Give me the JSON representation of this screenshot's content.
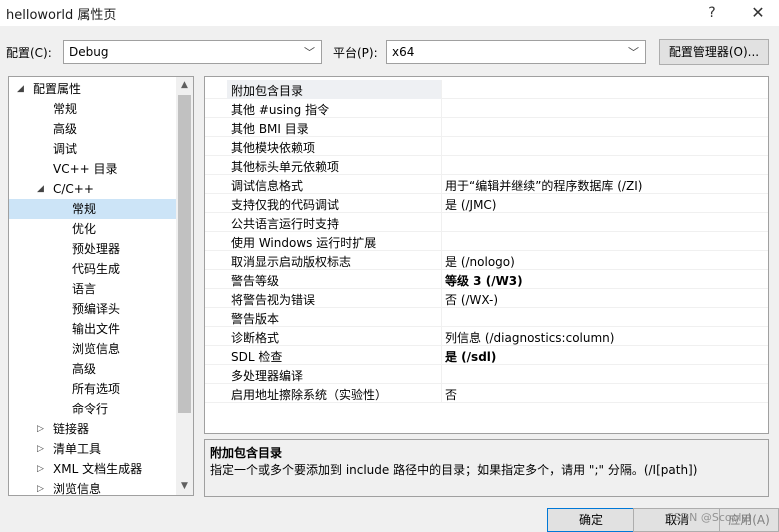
{
  "window": {
    "title": "helloworld 属性页",
    "help_icon": "?",
    "close_icon": "✕"
  },
  "config_bar": {
    "config_label": "配置(C):",
    "config_value": "Debug",
    "platform_label": "平台(P):",
    "platform_value": "x64",
    "manager_button": "配置管理器(O)..."
  },
  "tree": {
    "items": [
      {
        "label": "配置属性",
        "arrow": "◢"
      },
      {
        "label": "常规"
      },
      {
        "label": "高级"
      },
      {
        "label": "调试"
      },
      {
        "label": "VC++ 目录"
      },
      {
        "label": "C/C++",
        "arrow": "◢"
      },
      {
        "label": "常规",
        "selected": true
      },
      {
        "label": "优化"
      },
      {
        "label": "预处理器"
      },
      {
        "label": "代码生成"
      },
      {
        "label": "语言"
      },
      {
        "label": "预编译头"
      },
      {
        "label": "输出文件"
      },
      {
        "label": "浏览信息"
      },
      {
        "label": "高级"
      },
      {
        "label": "所有选项"
      },
      {
        "label": "命令行"
      },
      {
        "label": "链接器",
        "arrow": "▷"
      },
      {
        "label": "清单工具",
        "arrow": "▷"
      },
      {
        "label": "XML 文档生成器",
        "arrow": "▷"
      },
      {
        "label": "浏览信息",
        "arrow": "▷"
      }
    ]
  },
  "properties": [
    {
      "name": "附加包含目录",
      "value": ""
    },
    {
      "name": "其他 #using 指令",
      "value": ""
    },
    {
      "name": "其他 BMI 目录",
      "value": ""
    },
    {
      "name": "其他模块依赖项",
      "value": ""
    },
    {
      "name": "其他标头单元依赖项",
      "value": ""
    },
    {
      "name": "调试信息格式",
      "value": "用于“编辑并继续”的程序数据库 (/ZI)"
    },
    {
      "name": "支持仅我的代码调试",
      "value": "是 (/JMC)"
    },
    {
      "name": "公共语言运行时支持",
      "value": ""
    },
    {
      "name": "使用 Windows 运行时扩展",
      "value": ""
    },
    {
      "name": "取消显示启动版权标志",
      "value": "是 (/nologo)"
    },
    {
      "name": "警告等级",
      "value": "等级 3 (/W3)",
      "bold": true
    },
    {
      "name": "将警告视为错误",
      "value": "否 (/WX-)"
    },
    {
      "name": "警告版本",
      "value": ""
    },
    {
      "name": "诊断格式",
      "value": "列信息 (/diagnostics:column)"
    },
    {
      "name": "SDL 检查",
      "value": "是 (/sdl)",
      "bold": true
    },
    {
      "name": "多处理器编译",
      "value": ""
    },
    {
      "name": "启用地址擦除系统（实验性）",
      "value": "否"
    }
  ],
  "description": {
    "title": "附加包含目录",
    "text": "指定一个或多个要添加到 include 路径中的目录；如果指定多个，请用 \";\" 分隔。(/I[path])"
  },
  "buttons": {
    "ok": "确定",
    "cancel": "取消",
    "apply": "应用(A)"
  },
  "watermark": "CSDN @Scoolyl"
}
